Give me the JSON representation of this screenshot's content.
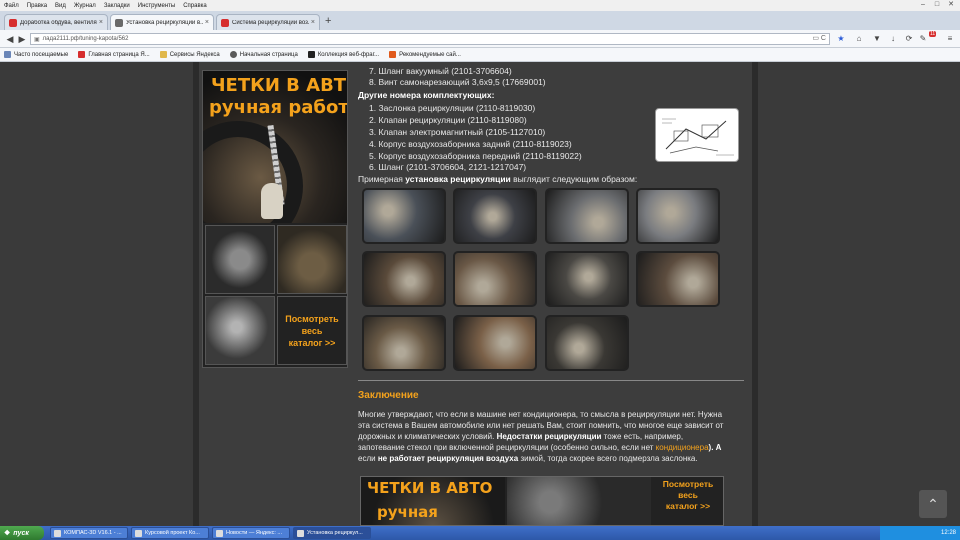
{
  "menubar": {
    "items": [
      "Файл",
      "Правка",
      "Вид",
      "Журнал",
      "Закладки",
      "Инструменты",
      "Справка"
    ]
  },
  "window_controls": {
    "minimize": "–",
    "maximize": "□",
    "close": "✕"
  },
  "tabs": [
    {
      "title": "Доработка обдува, вентиля...",
      "icon_color": "#d62e2e",
      "active": false
    },
    {
      "title": "Установка рециркуляции в...",
      "icon_color": "#6a6a6a",
      "active": true
    },
    {
      "title": "Система рециркуляции воз...",
      "icon_color": "#d62e2e",
      "active": false
    }
  ],
  "tab_close": "×",
  "new_tab": "+",
  "navbar": {
    "back": "◀",
    "forward": "▶",
    "url": "лада2111.рф/tuning-kapota/562",
    "end_icons": "▭  C"
  },
  "toolbar_icons": {
    "star": "★",
    "home": "⌂",
    "pocket": "▼",
    "download": "↓",
    "refresh": "⟳",
    "extension": "✎",
    "adblock_count": "11",
    "menu": "≡"
  },
  "bookmarks": [
    {
      "label": "Часто посещаемые",
      "icon_color": "#6a86b8"
    },
    {
      "label": "Главная страница Я...",
      "icon_color": "#d62e2e"
    },
    {
      "label": "Сервисы Яндекса",
      "icon_color": "#e0b84c"
    },
    {
      "label": "Начальная страница",
      "icon_color": "#5a5a5a"
    },
    {
      "label": "Коллекция веб-фраг...",
      "icon_color": "#222222"
    },
    {
      "label": "Рекомендуемые сай...",
      "icon_color": "#e05a1c"
    }
  ],
  "sidebar_ad": {
    "title_line1": "ЧЕТКИ В АВТО",
    "title_line2": "ручная работа",
    "cta_line1": "Посмотреть",
    "cta_line2": "весь",
    "cta_line3": "каталог >>"
  },
  "content": {
    "list1": [
      "7. Шланг вакуумный (2101-3706604)",
      "8. Винт самонарезающий 3,6х9,5 (17669001)"
    ],
    "other_numbers_header": "Другие номера комплектующих:",
    "list2": [
      "1. Заслонка рециркуляции (2110-8119030)",
      "2. Клапан рециркуляции (2110-8119080)",
      "3. Клапан электромагнитный (2105-1127010)",
      "4. Корпус воздухозаборника задний (2110-8119023)",
      "5. Корпус воздухозаборника передний (2110-8119022)",
      "6. Шланг (2101-3706604, 2121-1217047)"
    ],
    "install_text_a": "Примерная ",
    "install_text_b": "установка рециркуляции",
    "install_text_c": " выглядит следующим образом:",
    "conclusion_title": "Заключение",
    "p1": "Многие утверждают, что если в машине нет кондиционера, то смысла в рециркуляции нет. Нужна",
    "p2": "эта система в Вашем автомобиле или нет решать Вам, стоит помнить, что многое еще зависит от",
    "p3a": "дорожных и климатических условий. ",
    "p3b": "Недостатки рециркуляции",
    "p3c": " тоже есть, например,",
    "p4a": "запотевание стекол при включенной рециркуляции (особенно сильно, если нет ",
    "p4b": "кондиционера",
    "p4c": "). А",
    "p5a": "если ",
    "p5b": "не работает рециркуляция воздуха",
    "p5c": " зимой, тогда скорее всего подмерзла заслонка."
  },
  "thumb_colors": [
    "#4a5058",
    "#3e4046",
    "#6b6d70",
    "#7a7c80",
    "#5a4a3a",
    "#6a5846",
    "#4a4844",
    "#5c4c3e",
    "#6a5a46",
    "#7a6048",
    "#3a3834"
  ],
  "banner": {
    "title1": "ЧЕТКИ В АВТО",
    "title2": "ручная",
    "cta1": "Посмотреть",
    "cta2": "весь",
    "cta3": "каталог >>"
  },
  "scroll_top": "⌃",
  "taskbar": {
    "start": "пуск",
    "tasks": [
      {
        "label": "КОМПАС-3D V16.1 - ...",
        "active": false
      },
      {
        "label": "Курсовой проект Ко...",
        "active": false
      },
      {
        "label": "Новости — Яндекс: ...",
        "active": false
      },
      {
        "label": "Установка рециркул...",
        "active": true
      }
    ],
    "clock": "12:28"
  }
}
